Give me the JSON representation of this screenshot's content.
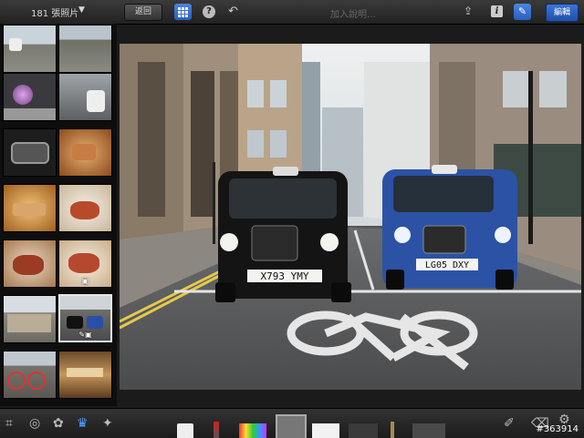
{
  "header": {
    "photo_count": "181 張照片",
    "back_label": "返回",
    "caption_placeholder": "加入說明…",
    "edit_label": "編輯"
  },
  "icons": {
    "count_dropdown": "chevron-down-icon",
    "grid": "grid-icon",
    "help": "help-icon",
    "undo": "undo-icon",
    "share": "share-icon",
    "info": "info-icon",
    "edit_tools": "edit-pen-icon",
    "crop": "crop-icon",
    "exposure": "exposure-icon",
    "color": "palette-icon",
    "brushes": "brushes-icon",
    "effects": "effects-icon",
    "brush_settings": "brush-settings-icon",
    "erase": "eraser-icon",
    "settings": "gear-icon"
  },
  "photo": {
    "plate_left": "X793 YMY",
    "plate_right": "LG05 DXY"
  },
  "footer": {
    "watermark": "#363914"
  },
  "colors": {
    "accent": "#2f68cf",
    "toolbar": "#2a2a2a"
  }
}
